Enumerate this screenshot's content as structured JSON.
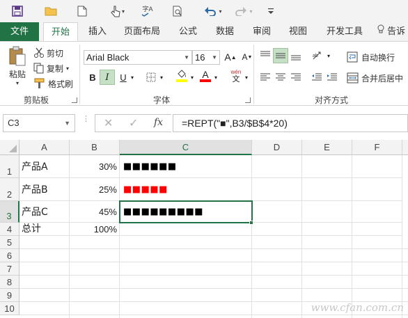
{
  "ribbon_tabs": [
    "文件",
    "开始",
    "插入",
    "页面布局",
    "公式",
    "数据",
    "审阅",
    "视图",
    "开发工具",
    "告诉"
  ],
  "clipboard": {
    "paste": "粘贴",
    "cut": "剪切",
    "copy": "复制",
    "format_painter": "格式刷",
    "group_label": "剪贴板"
  },
  "font": {
    "family": "Arial Black",
    "size": "16",
    "bold": "B",
    "italic": "I",
    "underline": "U",
    "grow": "A",
    "shrink": "A",
    "phonetic_top": "wén",
    "phonetic_bottom": "文",
    "font_color_letter": "A",
    "group_label": "字体",
    "highlight_color": "#ffff00",
    "font_color": "#ff0000"
  },
  "alignment": {
    "wrap_text": "自动换行",
    "merge_center": "合并后居中",
    "group_label": "对齐方式"
  },
  "formula_bar": {
    "name_box": "C3",
    "fx": "fx",
    "formula": "=REPT(\"■\",B3/$B$4*20)"
  },
  "columns": [
    "A",
    "B",
    "C",
    "D",
    "E",
    "F"
  ],
  "rows": [
    "1",
    "2",
    "3",
    "4",
    "5",
    "6",
    "7",
    "8",
    "9",
    "10"
  ],
  "cells": [
    {
      "a": "产品A",
      "b": "30%",
      "c": "■■■■■■",
      "c_color": "#000000"
    },
    {
      "a": "产品B",
      "b": "25%",
      "c": "■■■■■",
      "c_color": "#ff0000"
    },
    {
      "a": "产品C",
      "b": "45%",
      "c": "■■■■■■■■■",
      "c_color": "#000000"
    },
    {
      "a": "总计",
      "b": "100%",
      "c": "",
      "c_color": "#000000"
    }
  ],
  "accent_color": "#217346",
  "watermark": "www.cfan.com.cn"
}
